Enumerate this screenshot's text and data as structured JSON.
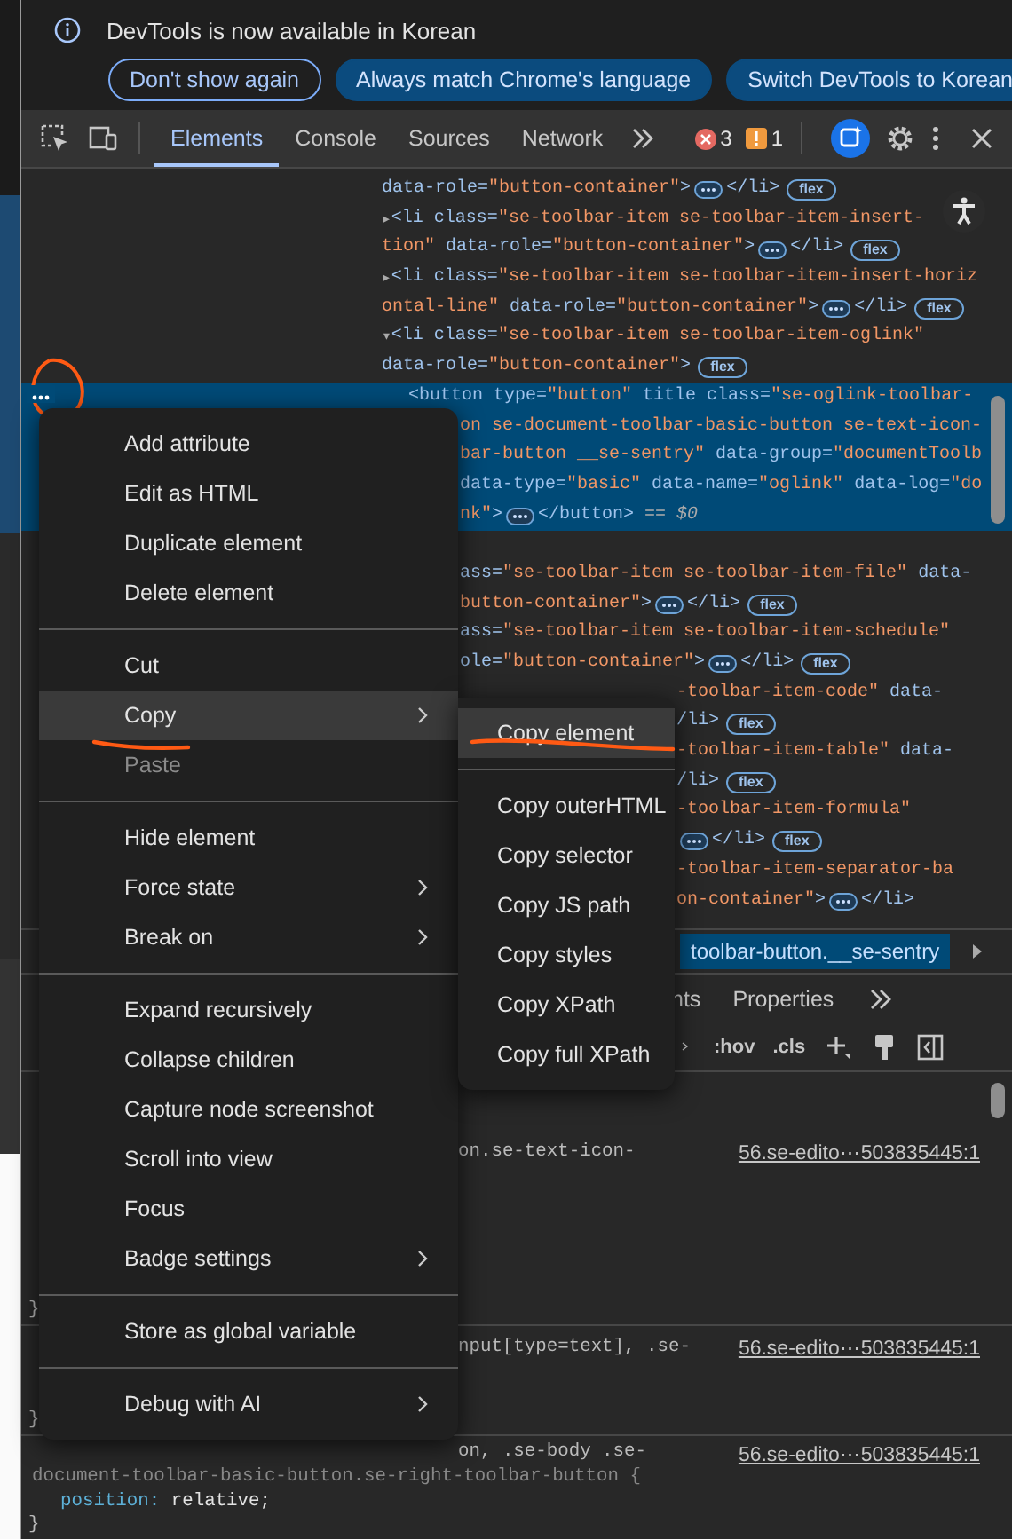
{
  "infobar": {
    "message": "DevTools is now available in Korean",
    "buttons": [
      {
        "label": "Don't show again",
        "kind": "outline"
      },
      {
        "label": "Always match Chrome's language",
        "kind": "filled"
      },
      {
        "label": "Switch DevTools to Korean",
        "kind": "filled"
      }
    ]
  },
  "toolbar": {
    "tabs": [
      {
        "label": "Elements",
        "selected": true
      },
      {
        "label": "Console",
        "selected": false
      },
      {
        "label": "Sources",
        "selected": false
      },
      {
        "label": "Network",
        "selected": false
      }
    ],
    "errors": "3",
    "warnings": "1"
  },
  "dom_tree": {
    "lines": [
      {
        "kind": "open",
        "selected": false,
        "tokens": [
          {
            "kind": "attr",
            "text": "data-role="
          },
          {
            "kind": "value",
            "text": "\"button-container\""
          },
          {
            "kind": "attr",
            "text": ">"
          },
          {
            "kind": "dots"
          },
          {
            "kind": "attr",
            "text": "</li>"
          },
          {
            "kind": "badge",
            "text": "flex"
          }
        ]
      },
      {
        "kind": "open",
        "selected": false,
        "tokens": [
          {
            "kind": "toggle",
            "text": "▸"
          },
          {
            "kind": "attr",
            "text": "<li class="
          },
          {
            "kind": "value",
            "text": "\"se-toolbar-item se-toolbar-item-insert-"
          }
        ]
      },
      {
        "kind": "open",
        "selected": false,
        "tokens": [
          {
            "kind": "value",
            "text": "tion\""
          },
          {
            "kind": "attr",
            "text": " data-role="
          },
          {
            "kind": "value",
            "text": "\"button-container\""
          },
          {
            "kind": "attr",
            "text": ">"
          },
          {
            "kind": "dots"
          },
          {
            "kind": "attr",
            "text": "</li>"
          },
          {
            "kind": "badge",
            "text": "flex"
          }
        ]
      },
      {
        "kind": "open",
        "selected": false,
        "tokens": [
          {
            "kind": "toggle",
            "text": "▸"
          },
          {
            "kind": "attr",
            "text": "<li class="
          },
          {
            "kind": "value",
            "text": "\"se-toolbar-item se-toolbar-item-insert-horiz"
          }
        ]
      },
      {
        "kind": "open",
        "selected": false,
        "tokens": [
          {
            "kind": "value",
            "text": "ontal-line\""
          },
          {
            "kind": "attr",
            "text": " data-role="
          },
          {
            "kind": "value",
            "text": "\"button-container\""
          },
          {
            "kind": "attr",
            "text": ">"
          },
          {
            "kind": "dots"
          },
          {
            "kind": "attr",
            "text": "</li>"
          },
          {
            "kind": "badge",
            "text": "flex"
          }
        ]
      },
      {
        "kind": "open",
        "selected": false,
        "tokens": [
          {
            "kind": "toggle",
            "text": "▾"
          },
          {
            "kind": "attr",
            "text": "<li class="
          },
          {
            "kind": "value",
            "text": "\"se-toolbar-item se-toolbar-item-oglink\""
          }
        ]
      },
      {
        "kind": "open",
        "selected": false,
        "tokens": [
          {
            "kind": "attr",
            "text": "data-role="
          },
          {
            "kind": "value",
            "text": "\"button-container\""
          },
          {
            "kind": "attr",
            "text": ">"
          },
          {
            "kind": "badge",
            "text": "flex"
          }
        ]
      },
      {
        "kind": "child",
        "selected": true,
        "tokens": [
          {
            "kind": "attr",
            "text": "<button type="
          },
          {
            "kind": "value",
            "text": "\"button\""
          },
          {
            "kind": "attr",
            "text": " title class="
          },
          {
            "kind": "value",
            "text": "\"se-oglink-toolbar-"
          }
        ]
      },
      {
        "kind": "under_menu",
        "selected": true,
        "tokens": [
          {
            "kind": "value",
            "text": "on se-document-toolbar-basic-button se-text-icon-"
          }
        ]
      },
      {
        "kind": "under_menu",
        "selected": true,
        "tokens": [
          {
            "kind": "value",
            "text": "bar-button __se-sentry\""
          },
          {
            "kind": "attr",
            "text": " data-group="
          },
          {
            "kind": "value",
            "text": "\"documentToolb"
          }
        ]
      },
      {
        "kind": "under_menu",
        "selected": true,
        "tokens": [
          {
            "kind": "attr",
            "text": "data-type="
          },
          {
            "kind": "value",
            "text": "\"basic\""
          },
          {
            "kind": "attr",
            "text": " data-name="
          },
          {
            "kind": "value",
            "text": "\"oglink\""
          },
          {
            "kind": "attr",
            "text": " data-log="
          },
          {
            "kind": "value",
            "text": "\"do"
          }
        ]
      },
      {
        "kind": "under_menu",
        "selected": true,
        "tokens": [
          {
            "kind": "value",
            "text": "nk\""
          },
          {
            "kind": "attr",
            "text": ">"
          },
          {
            "kind": "dots"
          },
          {
            "kind": "attr",
            "text": "</button>"
          },
          {
            "kind": "marker",
            "text": " == $0"
          }
        ]
      },
      {
        "kind": "under_menu",
        "selected": false,
        "tokens": [
          {
            "kind": "attr",
            "text": "ass="
          },
          {
            "kind": "value",
            "text": "\"se-toolbar-item se-toolbar-item-file\""
          },
          {
            "kind": "attr",
            "text": " data-"
          }
        ]
      },
      {
        "kind": "under_menu",
        "selected": false,
        "tokens": [
          {
            "kind": "value",
            "text": "button-container\""
          },
          {
            "kind": "attr",
            "text": ">"
          },
          {
            "kind": "dots"
          },
          {
            "kind": "attr",
            "text": "</li>"
          },
          {
            "kind": "badge",
            "text": "flex"
          }
        ]
      },
      {
        "kind": "under_menu",
        "selected": false,
        "tokens": [
          {
            "kind": "attr",
            "text": "ass="
          },
          {
            "kind": "value",
            "text": "\"se-toolbar-item se-toolbar-item-schedule\""
          }
        ]
      },
      {
        "kind": "under_menu",
        "selected": false,
        "tokens": [
          {
            "kind": "attr",
            "text": "ole="
          },
          {
            "kind": "value",
            "text": "\"button-container\""
          },
          {
            "kind": "attr",
            "text": ">"
          },
          {
            "kind": "dots"
          },
          {
            "kind": "attr",
            "text": "</li>"
          },
          {
            "kind": "badge",
            "text": "flex"
          }
        ]
      },
      {
        "kind": "under_submenu",
        "selected": false,
        "tokens": [
          {
            "kind": "value",
            "text": "-toolbar-item-code\""
          },
          {
            "kind": "attr",
            "text": " data-"
          }
        ]
      },
      {
        "kind": "under_submenu",
        "selected": false,
        "tokens": [
          {
            "kind": "attr",
            "text": "/li>"
          },
          {
            "kind": "badge",
            "text": "flex"
          }
        ]
      },
      {
        "kind": "under_submenu",
        "selected": false,
        "tokens": [
          {
            "kind": "value",
            "text": "-toolbar-item-table\""
          },
          {
            "kind": "attr",
            "text": " data-"
          }
        ]
      },
      {
        "kind": "under_submenu",
        "selected": false,
        "tokens": [
          {
            "kind": "attr",
            "text": "/li>"
          },
          {
            "kind": "badge",
            "text": "flex"
          }
        ]
      },
      {
        "kind": "under_submenu",
        "selected": false,
        "tokens": [
          {
            "kind": "value",
            "text": "-toolbar-item-formula\""
          }
        ]
      },
      {
        "kind": "under_submenu",
        "selected": false,
        "tokens": [
          {
            "kind": "dots"
          },
          {
            "kind": "attr",
            "text": "</li>"
          },
          {
            "kind": "badge",
            "text": "flex"
          }
        ]
      },
      {
        "kind": "under_submenu",
        "selected": false,
        "tokens": [
          {
            "kind": "value",
            "text": "-toolbar-item-separator-ba"
          }
        ]
      },
      {
        "kind": "under_submenu",
        "selected": false,
        "tokens": [
          {
            "kind": "value",
            "text": "on-container\""
          },
          {
            "kind": "attr",
            "text": ">"
          },
          {
            "kind": "dots"
          },
          {
            "kind": "attr",
            "text": "</li>"
          }
        ]
      }
    ]
  },
  "breadcrumb": {
    "text": "toolbar-button.__se-sentry"
  },
  "styles_tabs": [
    {
      "label": "nts"
    },
    {
      "label": "Properties"
    }
  ],
  "styles_toolbar": {
    "buttons": [
      ":hov",
      ".cls"
    ]
  },
  "rules": [
    {
      "selector_lines": [
        {
          "kind": "under_menu",
          "text": "on.se-text-icon-"
        }
      ],
      "source": "56.se-edito⋯503835445:1",
      "closing": "}"
    },
    {
      "selector_lines": [
        {
          "kind": "under_menu",
          "text": "nput[type=text], .se-"
        }
      ],
      "source": "56.se-edito⋯503835445:1",
      "closing": "}"
    },
    {
      "selector_lines": [
        {
          "kind": "under_menu",
          "text": "on, .se-body .se-"
        },
        {
          "kind": "open",
          "text": "document-toolbar-basic-button.se-right-toolbar-button {"
        }
      ],
      "source": "56.se-edito⋯503835445:1",
      "declarations": [
        {
          "property": "position:",
          "value": "relative;"
        }
      ],
      "closing": "}"
    }
  ],
  "context_menu": {
    "groups": [
      [
        {
          "label": "Add attribute",
          "selected": false,
          "disabled": false,
          "submenu": false
        },
        {
          "label": "Edit as HTML",
          "selected": false,
          "disabled": false,
          "submenu": false
        },
        {
          "label": "Duplicate element",
          "selected": false,
          "disabled": false,
          "submenu": false
        },
        {
          "label": "Delete element",
          "selected": false,
          "disabled": false,
          "submenu": false
        }
      ],
      [
        {
          "label": "Cut",
          "selected": false,
          "disabled": false,
          "submenu": false
        },
        {
          "label": "Copy",
          "selected": true,
          "disabled": false,
          "submenu": true
        },
        {
          "label": "Paste",
          "selected": false,
          "disabled": true,
          "submenu": false
        }
      ],
      [
        {
          "label": "Hide element",
          "selected": false,
          "disabled": false,
          "submenu": false
        },
        {
          "label": "Force state",
          "selected": false,
          "disabled": false,
          "submenu": true
        },
        {
          "label": "Break on",
          "selected": false,
          "disabled": false,
          "submenu": true
        }
      ],
      [
        {
          "label": "Expand recursively",
          "selected": false,
          "disabled": false,
          "submenu": false
        },
        {
          "label": "Collapse children",
          "selected": false,
          "disabled": false,
          "submenu": false
        },
        {
          "label": "Capture node screenshot",
          "selected": false,
          "disabled": false,
          "submenu": false
        },
        {
          "label": "Scroll into view",
          "selected": false,
          "disabled": false,
          "submenu": false
        },
        {
          "label": "Focus",
          "selected": false,
          "disabled": false,
          "submenu": false
        },
        {
          "label": "Badge settings",
          "selected": false,
          "disabled": false,
          "submenu": true
        }
      ],
      [
        {
          "label": "Store as global variable",
          "selected": false,
          "disabled": false,
          "submenu": false
        }
      ],
      [
        {
          "label": "Debug with AI",
          "selected": false,
          "disabled": false,
          "submenu": true
        }
      ]
    ],
    "submenu": {
      "groups": [
        [
          {
            "label": "Copy element",
            "selected": true
          }
        ],
        [
          {
            "label": "Copy outerHTML",
            "selected": false
          },
          {
            "label": "Copy selector",
            "selected": false
          },
          {
            "label": "Copy JS path",
            "selected": false
          },
          {
            "label": "Copy styles",
            "selected": false
          },
          {
            "label": "Copy XPath",
            "selected": false
          },
          {
            "label": "Copy full XPath",
            "selected": false
          }
        ]
      ]
    }
  }
}
